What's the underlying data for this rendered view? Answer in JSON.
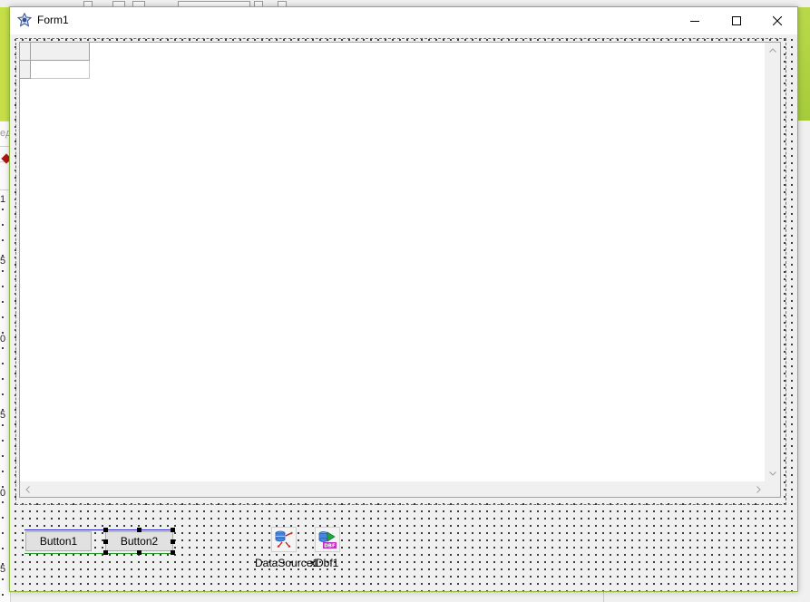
{
  "window": {
    "title": "Form1",
    "accent_color": "#8db53f"
  },
  "titlebar": {
    "minimize_icon": "minimize-icon",
    "maximize_icon": "maximize-icon",
    "close_icon": "close-icon"
  },
  "background": {
    "left_fragment": "eд",
    "ruler_numbers": [
      "1",
      "5",
      "0",
      "5",
      "0",
      "5"
    ]
  },
  "buttons": {
    "button1": "Button1",
    "button2": "Button2"
  },
  "components": {
    "datasource": {
      "label": "DataSource1",
      "icon": "datasource-icon"
    },
    "dbf": {
      "label": "xDbf1",
      "icon": "dbf-table-icon",
      "badge": "DBF"
    }
  },
  "colors": {
    "anchor_blue": "#1c1cd6",
    "anchor_green": "#2a9b2a",
    "green_band": "#c6df46"
  }
}
